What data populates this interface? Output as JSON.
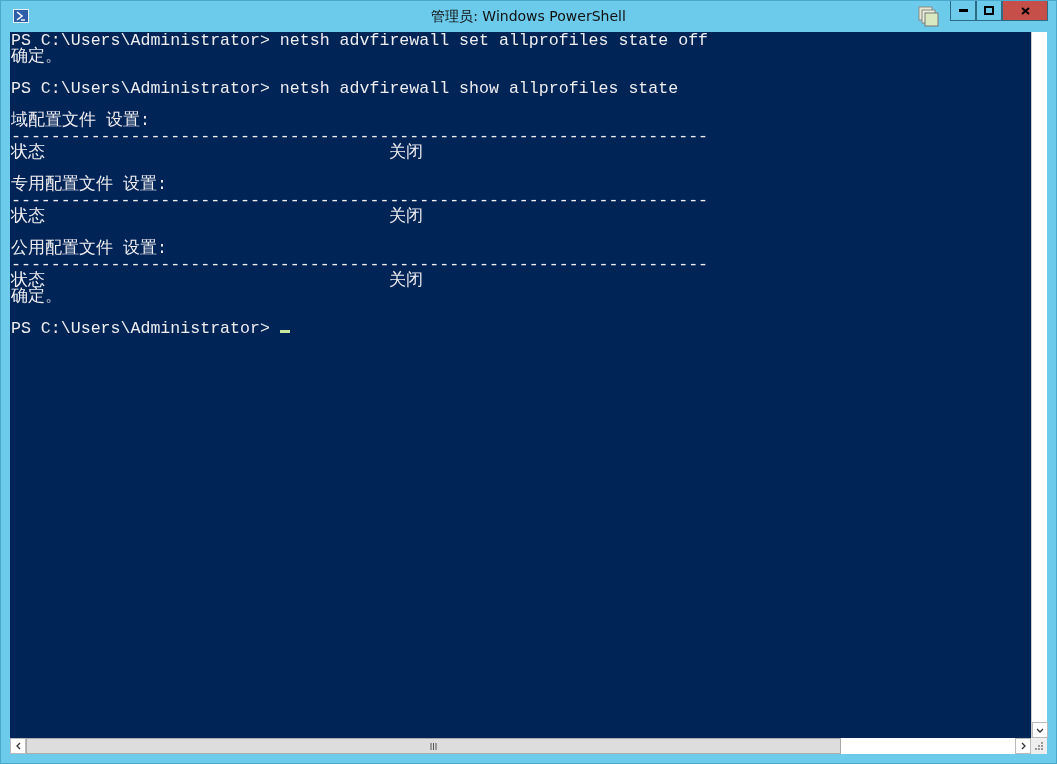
{
  "window": {
    "title": "管理员: Windows PowerShell"
  },
  "console": {
    "lines": [
      {
        "kind": "text",
        "text": "PS C:\\Users\\Administrator> netsh advfirewall set allprofiles state off"
      },
      {
        "kind": "text",
        "text": "确定。"
      },
      {
        "kind": "blank"
      },
      {
        "kind": "text",
        "text": "PS C:\\Users\\Administrator> netsh advfirewall show allprofiles state"
      },
      {
        "kind": "blank"
      },
      {
        "kind": "text",
        "text": "域配置文件 设置:"
      },
      {
        "kind": "text",
        "text": "----------------------------------------------------------------------"
      },
      {
        "kind": "row",
        "label": "状态",
        "value": "关闭"
      },
      {
        "kind": "blank"
      },
      {
        "kind": "text",
        "text": "专用配置文件 设置:"
      },
      {
        "kind": "text",
        "text": "----------------------------------------------------------------------"
      },
      {
        "kind": "row",
        "label": "状态",
        "value": "关闭"
      },
      {
        "kind": "blank"
      },
      {
        "kind": "text",
        "text": "公用配置文件 设置:"
      },
      {
        "kind": "text",
        "text": "----------------------------------------------------------------------"
      },
      {
        "kind": "row",
        "label": "状态",
        "value": "关闭"
      },
      {
        "kind": "text",
        "text": "确定。"
      },
      {
        "kind": "blank"
      },
      {
        "kind": "prompt",
        "text": "PS C:\\Users\\Administrator> ",
        "cursor": true
      }
    ]
  }
}
